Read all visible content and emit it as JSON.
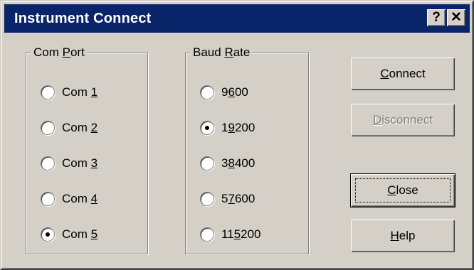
{
  "window": {
    "title": "Instrument Connect",
    "help_glyph": "?",
    "close_glyph": "✕"
  },
  "com_port": {
    "legend_pre": "Com ",
    "legend_key": "P",
    "legend_post": "ort",
    "items": [
      {
        "pre": "Com ",
        "key": "1",
        "post": ""
      },
      {
        "pre": "Com ",
        "key": "2",
        "post": ""
      },
      {
        "pre": "Com ",
        "key": "3",
        "post": ""
      },
      {
        "pre": "Com ",
        "key": "4",
        "post": ""
      },
      {
        "pre": "Com ",
        "key": "5",
        "post": ""
      }
    ],
    "selected": "Com 5"
  },
  "baud_rate": {
    "legend_pre": "Baud ",
    "legend_key": "R",
    "legend_post": "ate",
    "items": [
      {
        "pre": "9",
        "key": "6",
        "post": "00"
      },
      {
        "pre": "1",
        "key": "9",
        "post": "200"
      },
      {
        "pre": "3",
        "key": "8",
        "post": "400"
      },
      {
        "pre": "5",
        "key": "7",
        "post": "600"
      },
      {
        "pre": "11",
        "key": "5",
        "post": "200"
      }
    ],
    "selected": "19200"
  },
  "buttons": {
    "connect": {
      "pre": "",
      "key": "C",
      "post": "onnect"
    },
    "disconnect": {
      "pre": "",
      "key": "D",
      "post": "isconnect"
    },
    "close": {
      "pre": "",
      "key": "C",
      "post": "lose"
    },
    "help": {
      "pre": "",
      "key": "H",
      "post": "elp"
    }
  }
}
